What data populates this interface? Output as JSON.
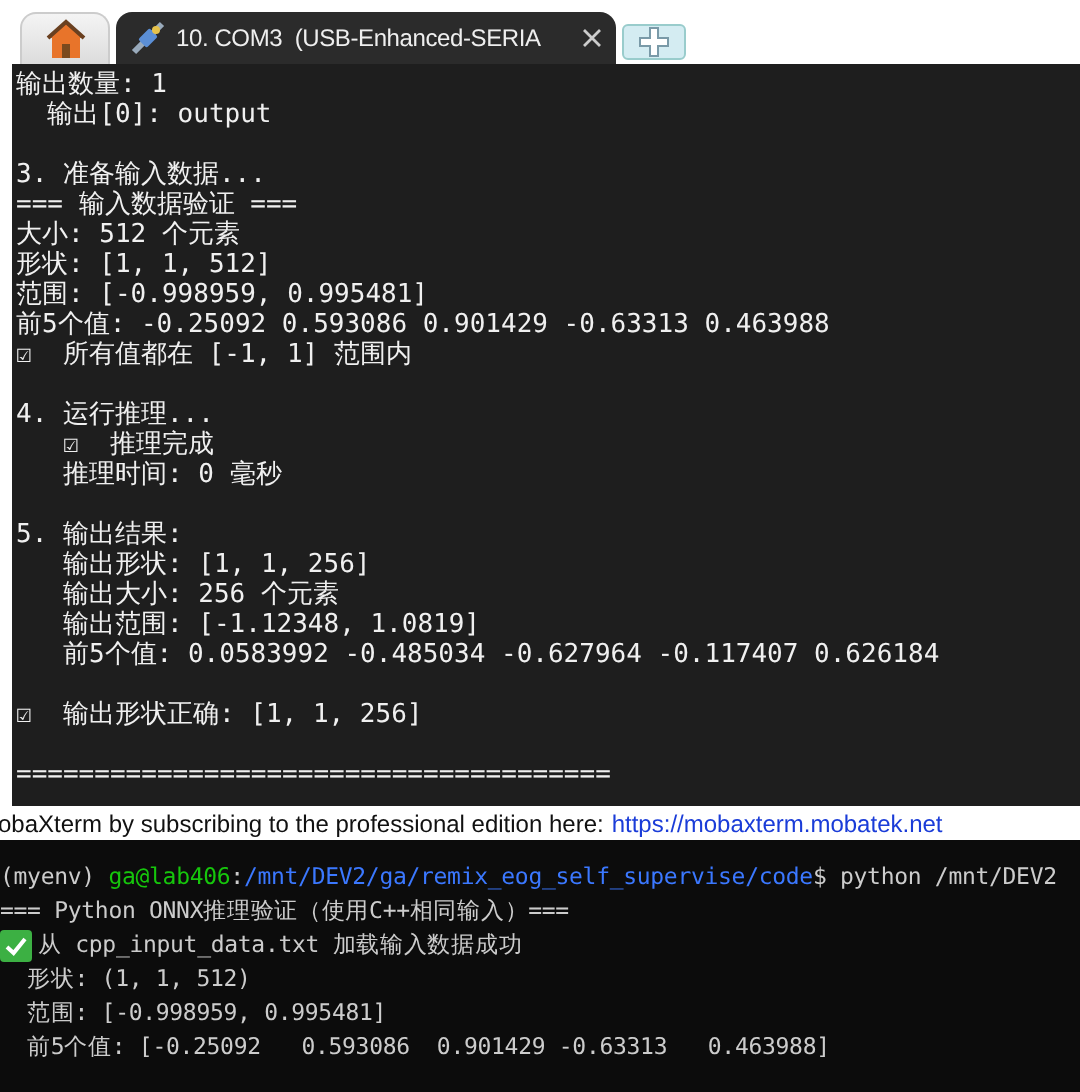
{
  "tabs": [
    {
      "kind": "home",
      "selected": false
    },
    {
      "kind": "session",
      "label": "10. COM3  (USB-Enhanced-SERIA",
      "selected": true
    },
    {
      "kind": "new",
      "selected": false
    }
  ],
  "terminal": {
    "blocks": [
      [
        "输出数量: 1",
        "  输出[0]: output"
      ],
      [
        "3. 准备输入数据...",
        "=== 输入数据验证 ===",
        "大小: 512 个元素",
        "形状: [1, 1, 512]",
        "范围: [-0.998959, 0.995481]",
        "前5个值: -0.25092 0.593086 0.901429 -0.63313 0.463988",
        "☑  所有值都在 [-1, 1] 范围内"
      ],
      [
        "4. 运行推理...",
        "   ☑  推理完成",
        "   推理时间: 0 毫秒"
      ],
      [
        "5. 输出结果:",
        "   输出形状: [1, 1, 256]",
        "   输出大小: 256 个元素",
        "   输出范围: [-1.12348, 1.0819]",
        "   前5个值: 0.0583992 -0.485034 -0.627964 -0.117407 0.626184"
      ],
      [
        "☑  输出形状正确: [1, 1, 256]"
      ],
      [
        "======================================"
      ]
    ]
  },
  "banner": {
    "text": "obaXterm by subscribing to the professional edition here:",
    "link": "https://mobaxterm.mobatek.net"
  },
  "terminal_2": {
    "lines": [
      {
        "kind": "prompt",
        "segments": [
          {
            "kind": "plain",
            "text": "(myenv) "
          },
          {
            "kind": "user",
            "text": "ga@lab406"
          },
          {
            "kind": "plain",
            "text": ":"
          },
          {
            "kind": "path",
            "text": "/mnt/DEV2/ga/remix_eog_self_supervise/code"
          },
          {
            "kind": "plain",
            "text": "$ python /mnt/DEV2"
          }
        ]
      },
      {
        "kind": "plain",
        "text": "=== Python ONNX推理验证（使用C++相同输入）==="
      },
      {
        "kind": "check",
        "text": "从 cpp_input_data.txt 加载输入数据成功"
      },
      {
        "kind": "plain",
        "text": "  形状: (1, 1, 512)"
      },
      {
        "kind": "plain",
        "text": "  范围: [-0.998959, 0.995481]"
      },
      {
        "kind": "plain",
        "text": "  前5个值: [-0.25092   0.593086  0.901429 -0.63313   0.463988]"
      }
    ]
  }
}
